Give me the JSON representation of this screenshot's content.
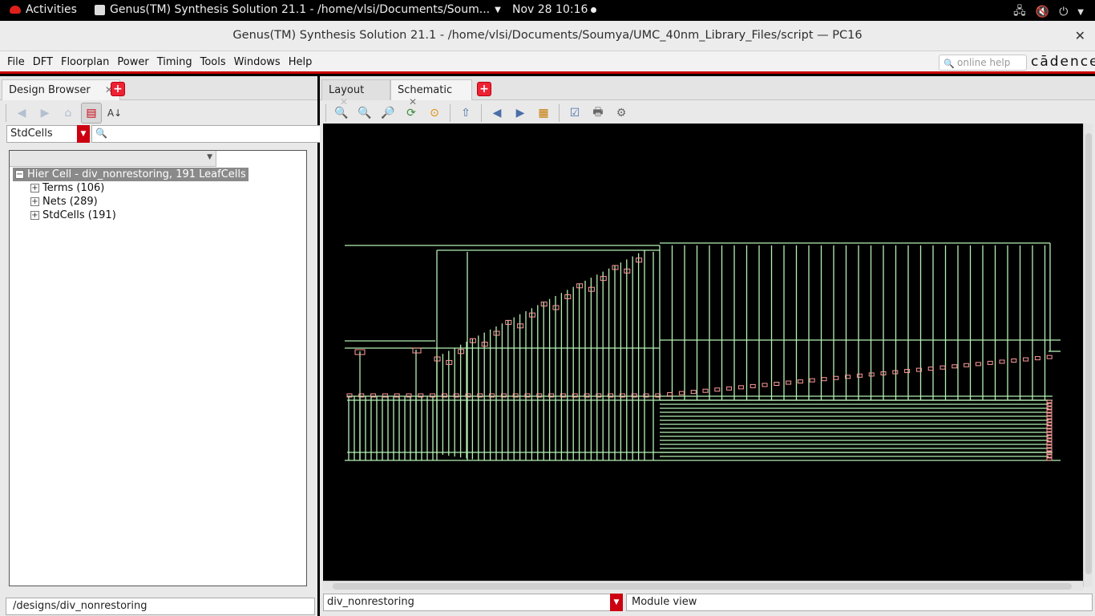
{
  "topbar": {
    "activities": "Activities",
    "app_menu": "Genus(TM) Synthesis Solution 21.1 - /home/vlsi/Documents/Soum...",
    "clock": "Nov 28  10:16"
  },
  "window": {
    "title": "Genus(TM) Synthesis Solution 21.1 - /home/vlsi/Documents/Soumya/UMC_40nm_Library_Files/script — PC16",
    "close": "✕"
  },
  "menubar": {
    "items": [
      "File",
      "DFT",
      "Floorplan",
      "Power",
      "Timing",
      "Tools",
      "Windows",
      "Help"
    ],
    "help_placeholder": "online help",
    "logo": "cādence"
  },
  "left_panel": {
    "tab": "Design Browser",
    "filter_value": "StdCells",
    "tree": {
      "root": "Hier Cell - div_nonrestoring, 191 LeafCells",
      "children": [
        "Terms (106)",
        "Nets (289)",
        "StdCells (191)"
      ]
    },
    "path": "/designs/div_nonrestoring"
  },
  "right_panel": {
    "tabs": [
      "Layout",
      "Schematic"
    ],
    "active_tab": "Schematic",
    "module_select": "div_nonrestoring",
    "view_mode": "Module view"
  },
  "colors": {
    "wire": "#b4f0b4",
    "cell": "#ff9a9a",
    "accent": "#cc0011"
  }
}
